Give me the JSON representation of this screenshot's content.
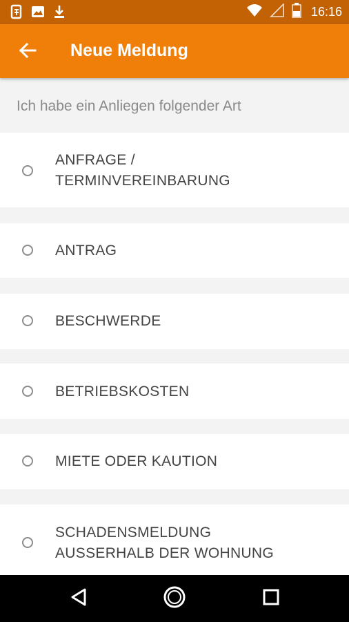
{
  "status_bar": {
    "time": "16:16",
    "left_icons": [
      "sim-card-icon",
      "image-icon",
      "download-icon"
    ],
    "right_icons": [
      "wifi-icon",
      "signal-icon",
      "battery-icon"
    ]
  },
  "app_bar": {
    "title": "Neue Meldung",
    "back_icon": "arrow-left-icon",
    "color": "#f07f09"
  },
  "subheader": {
    "text": "Ich habe ein Anliegen folgender Art"
  },
  "options": [
    {
      "line1": "ANFRAGE /",
      "line2": "TERMINVEREINBARUNG",
      "selected": false
    },
    {
      "line1": "ANTRAG",
      "line2": "",
      "selected": false
    },
    {
      "line1": "BESCHWERDE",
      "line2": "",
      "selected": false
    },
    {
      "line1": "BETRIEBSKOSTEN",
      "line2": "",
      "selected": false
    },
    {
      "line1": "MIETE ODER KAUTION",
      "line2": "",
      "selected": false
    },
    {
      "line1": "SCHADENSMELDUNG",
      "line2": "AUSSERHALB DER WOHNUNG",
      "selected": false
    }
  ],
  "nav_bar": {
    "icons": [
      "back-triangle-icon",
      "home-circle-icon",
      "recents-square-icon"
    ]
  }
}
